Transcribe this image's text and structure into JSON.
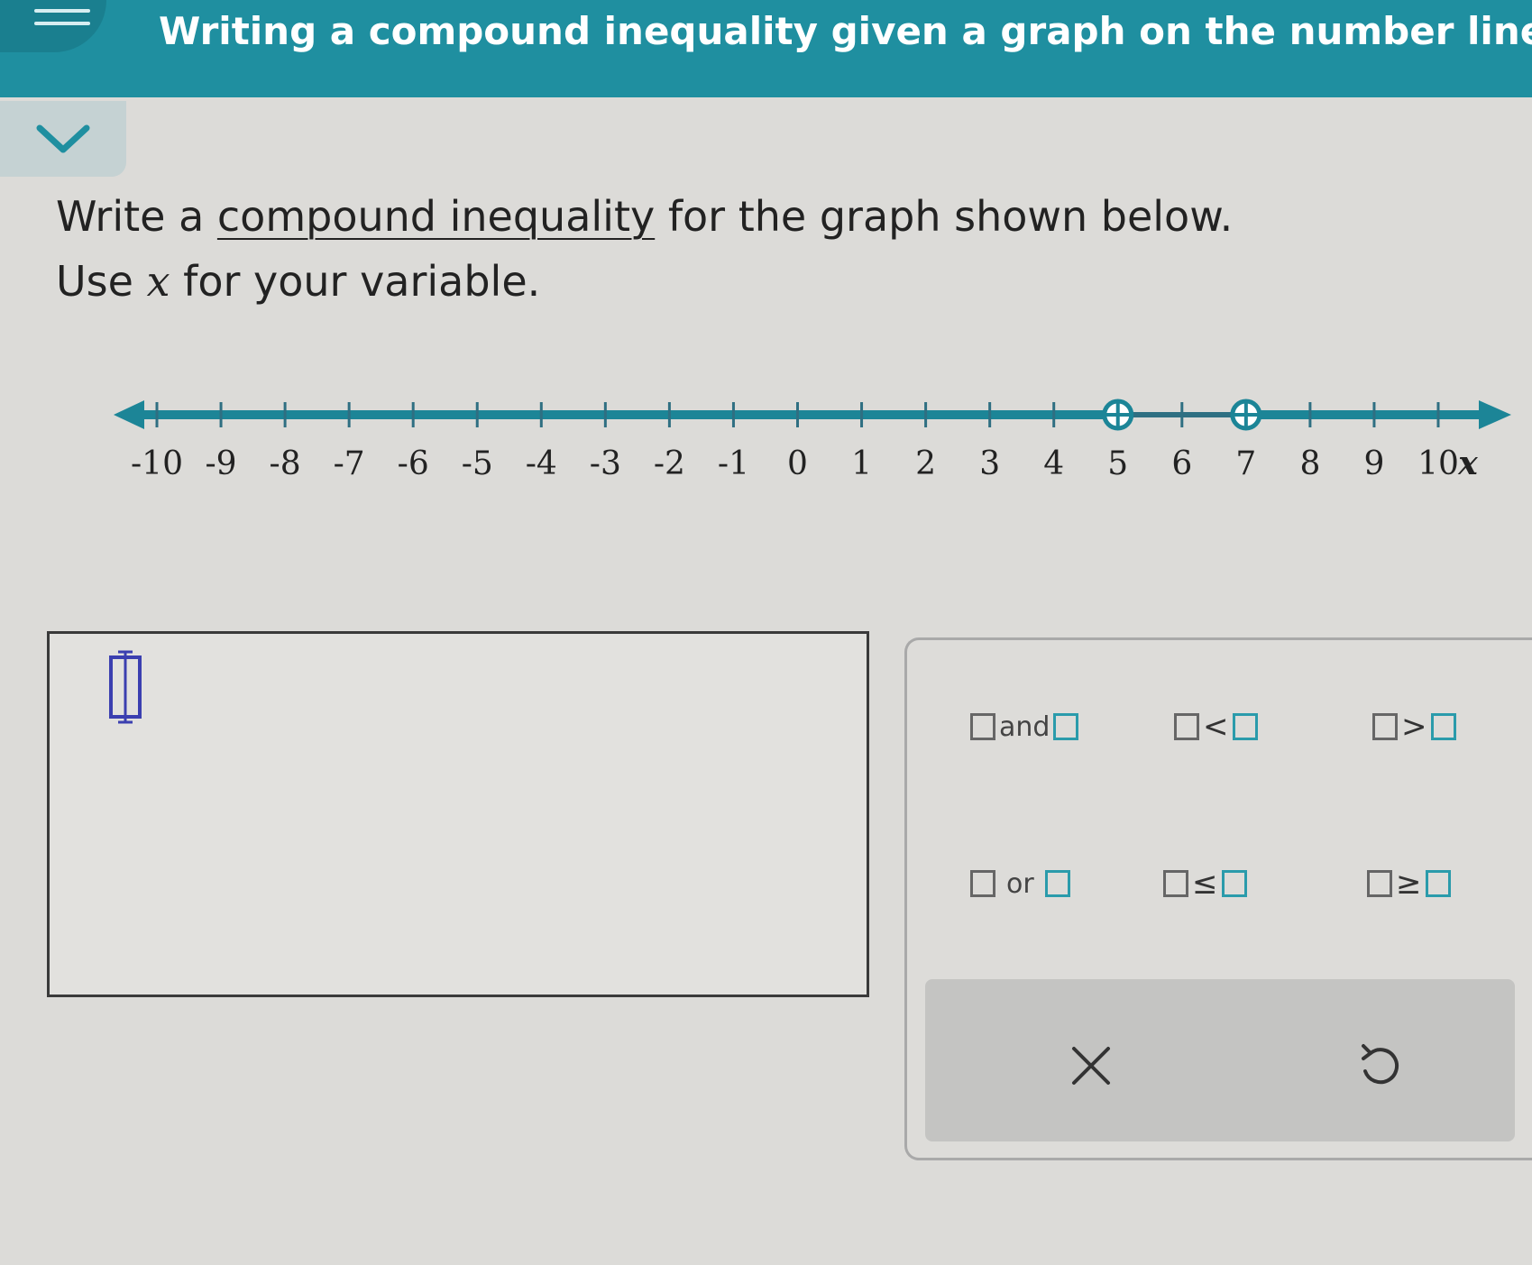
{
  "header": {
    "title": "Writing a compound inequality given a graph on the number line"
  },
  "question": {
    "line1_prefix": "Write a ",
    "line1_link": "compound inequality",
    "line1_suffix": " for the graph shown below.",
    "line2_prefix": "Use ",
    "line2_var": "x",
    "line2_suffix": " for your variable."
  },
  "number_line": {
    "min": -10,
    "max": 10,
    "tick_labels": [
      "-10",
      "-9",
      "-8",
      "-7",
      "-6",
      "-5",
      "-4",
      "-3",
      "-2",
      "-1",
      "0",
      "1",
      "2",
      "3",
      "4",
      "5",
      "6",
      "7",
      "8",
      "9",
      "10"
    ],
    "variable_label": "x",
    "open_points": [
      5,
      7
    ],
    "shaded": [
      {
        "from": -10,
        "to": 5,
        "arrow": "left"
      },
      {
        "from": 7,
        "to": 10,
        "arrow": "right"
      }
    ],
    "colors": {
      "line": "#2f6f82",
      "shade": "#1c8597"
    }
  },
  "palette": {
    "and_word": "and",
    "or_word": "or",
    "lt": "<",
    "gt": ">",
    "le": "≤",
    "ge": "≥",
    "clear_icon": "close-icon",
    "undo_icon": "undo-icon"
  }
}
